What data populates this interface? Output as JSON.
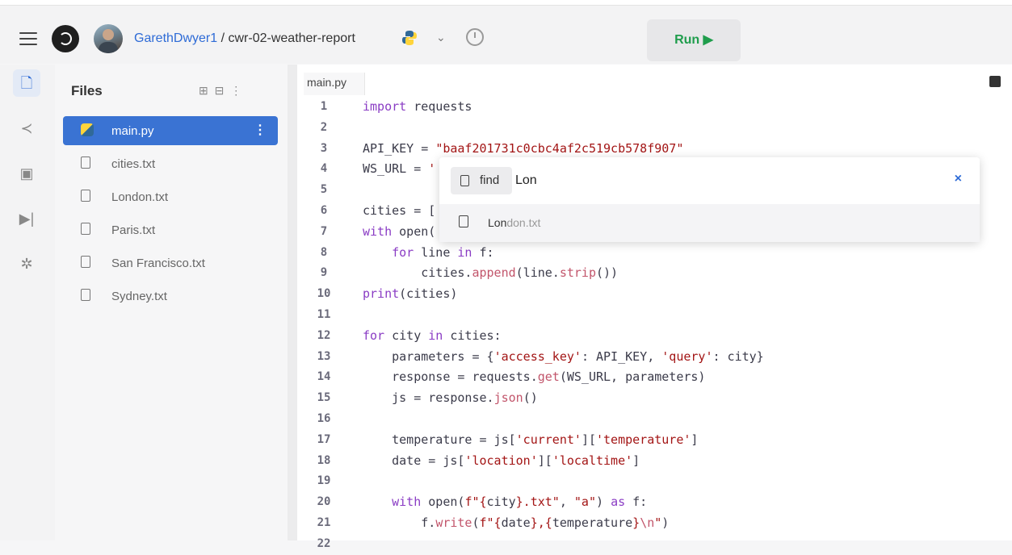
{
  "header": {
    "username": "GarethDwyer1",
    "separator": " / ",
    "repo": "cwr-02-weather-report",
    "chevron": "⌄",
    "run_label": "Run ▶"
  },
  "rail": {
    "icons": [
      "files-icon",
      "share-icon",
      "packages-icon",
      "debugger-icon",
      "settings-icon"
    ]
  },
  "files": {
    "title": "Files",
    "actions": "⊞ ⊟ ⋮",
    "items": [
      {
        "name": "main.py",
        "selected": true
      },
      {
        "name": "cities.txt"
      },
      {
        "name": "London.txt"
      },
      {
        "name": "Paris.txt"
      },
      {
        "name": "San Francisco.txt"
      },
      {
        "name": "Sydney.txt"
      }
    ],
    "kebab": "⋮"
  },
  "editor": {
    "tab": "main.py",
    "line_numbers": [
      "1",
      "2",
      "3",
      "4",
      "5",
      "6",
      "7",
      "8",
      "9",
      "10",
      "11",
      "12",
      "13",
      "14",
      "15",
      "16",
      "17",
      "18",
      "19",
      "20",
      "21",
      "22"
    ]
  },
  "finder": {
    "chip_label": "find",
    "query": "Lon",
    "close": "×",
    "result_match": "Lon",
    "result_rest": "don.txt"
  },
  "colors": {
    "accent": "#2e6bd6",
    "run": "#1f9d4c",
    "keyword": "#8a3cc4",
    "string": "#a31515"
  }
}
